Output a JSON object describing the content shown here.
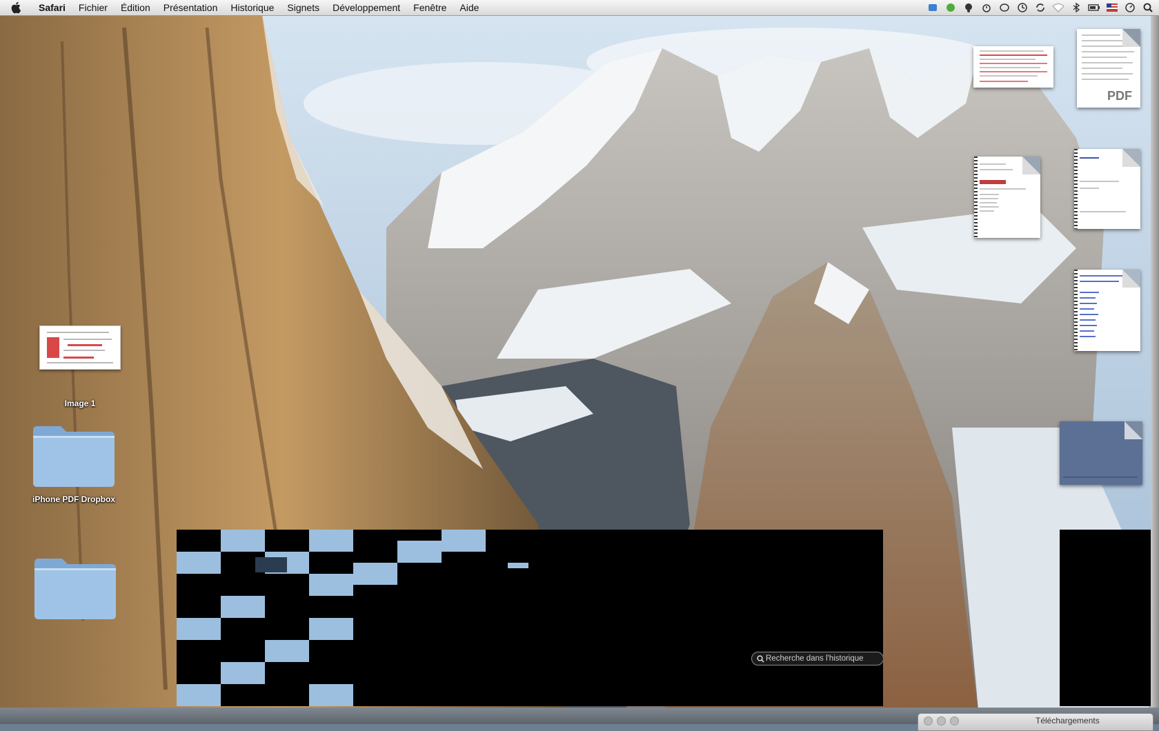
{
  "menubar": {
    "app_name": "Safari",
    "items": [
      "Fichier",
      "Édition",
      "Présentation",
      "Historique",
      "Signets",
      "Développement",
      "Fenêtre",
      "Aide"
    ],
    "extras": [
      "dropbox-icon",
      "evernote-icon",
      "adium-icon",
      "time-icon",
      "chat-icon",
      "time-machine-icon",
      "sync-icon",
      "wifi-icon",
      "bluetooth-icon",
      "battery-icon",
      "flag-icon",
      "clock-icon",
      "spotlight-icon"
    ]
  },
  "desktop": {
    "icons": [
      {
        "label": "Image 1"
      },
      {
        "label": "iPhone PDF Dropbox"
      },
      {
        "label": ""
      }
    ],
    "right_docs": {
      "pdf_label": "PDF"
    }
  },
  "history_search": {
    "placeholder": "Recherche dans l'historique"
  },
  "downloads": {
    "title": "Téléchargements"
  },
  "colors": {
    "folder_blue": "#8fb8e0",
    "tile_blue": "#9cbfdf",
    "menubar": "#e8e8e8"
  }
}
